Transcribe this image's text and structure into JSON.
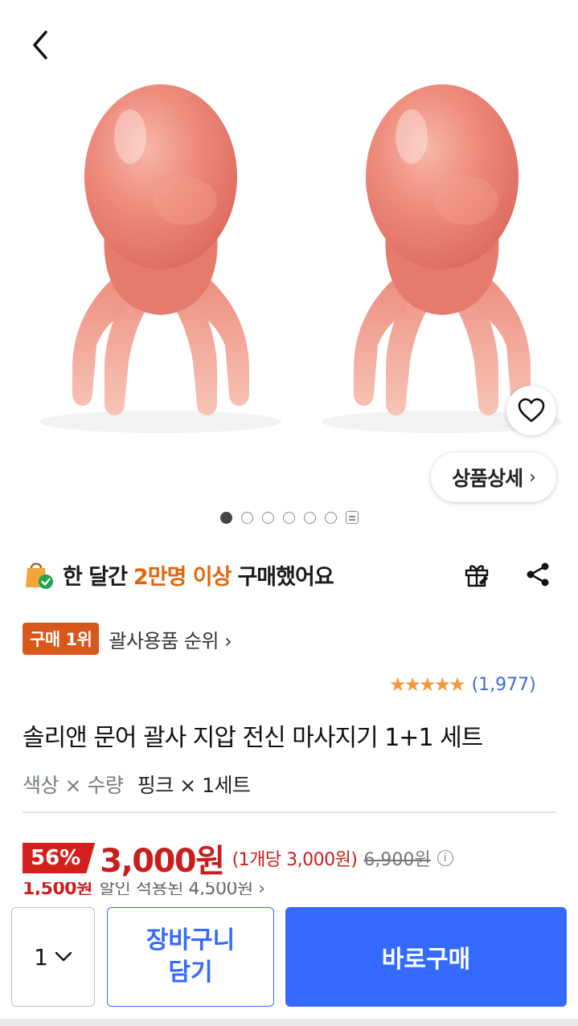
{
  "header": {
    "back_icon": "chevron-left-icon"
  },
  "gallery": {
    "image_subject": "pink octopus gua sha massagers",
    "total_images": 6,
    "active_index": 0,
    "has_video_indicator": true,
    "wishlist_icon": "heart-outline-icon",
    "detail_button_label": "상품상세",
    "detail_button_chevron": "›"
  },
  "social_proof": {
    "icon": "shopping-bag-check-icon",
    "prefix": "한 달간",
    "highlight": "2만명 이상",
    "suffix": "구매했어요"
  },
  "actions": {
    "gift_icon": "gift-icon",
    "share_icon": "share-icon"
  },
  "ranking": {
    "badge": "구매 1위",
    "link_label": "괄사용품 순위 ›"
  },
  "rating": {
    "stars": 5,
    "review_count": "(1,977)"
  },
  "product": {
    "title": "솔리앤 문어 괄사 지압 전신 마사지기 1+1 세트",
    "option_label": "색상 × 수량",
    "option_value": "핑크 × 1세트"
  },
  "price": {
    "discount": "56%",
    "sale_price": "3,000원",
    "unit_price": "(1개당 3,000원)",
    "original_price": "6,900원",
    "info_icon": "info-icon"
  },
  "coupon_line": {
    "amount": "1,500원",
    "text": "할인 적용된 4,500원 ›"
  },
  "bottom_bar": {
    "quantity": "1",
    "quantity_chevron": "⌄",
    "cart_line1": "장바구니",
    "cart_line2": "담기",
    "buy_now": "바로구매"
  },
  "colors": {
    "accent_blue": "#346aff",
    "price_red": "#c81e1e",
    "highlight_orange": "#e2640c",
    "rank_badge": "#d9571b",
    "star": "#f19a3b"
  }
}
